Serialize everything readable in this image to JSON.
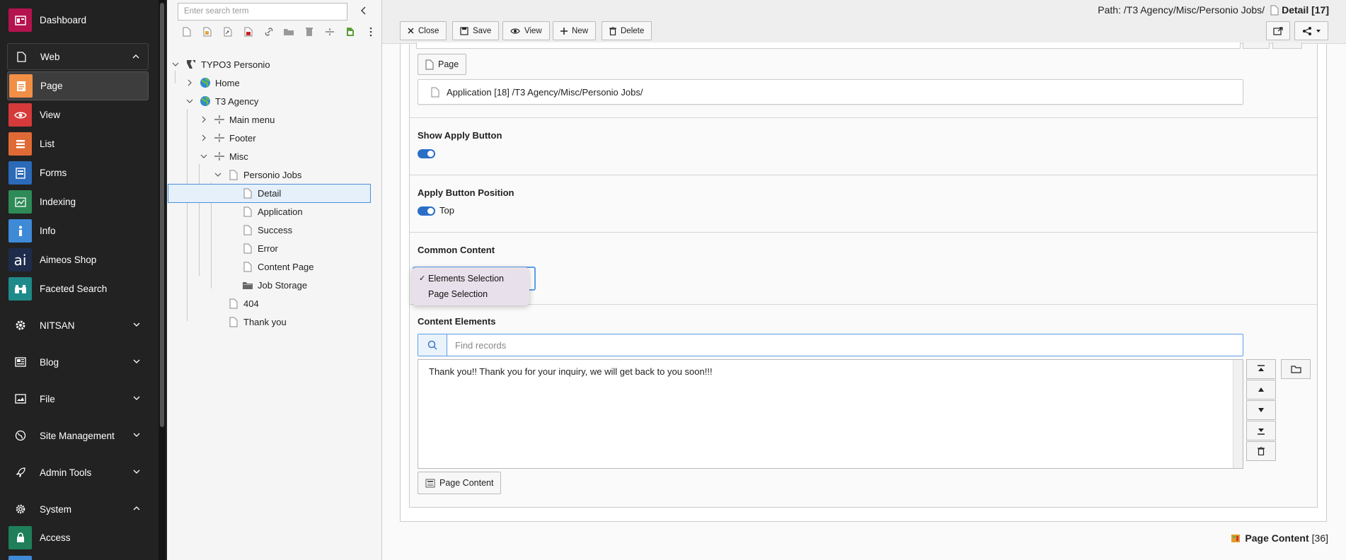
{
  "module_menu": {
    "dashboard": "Dashboard",
    "web_group": "Web",
    "items": [
      {
        "label": "Page",
        "icon": "page-icon",
        "color": "#f18f47"
      },
      {
        "label": "View",
        "icon": "eye-icon",
        "color": "#d63a3a"
      },
      {
        "label": "List",
        "icon": "list-icon",
        "color": "#e06a36"
      },
      {
        "label": "Forms",
        "icon": "forms-icon",
        "color": "#2a6ab8"
      },
      {
        "label": "Indexing",
        "icon": "indexing-icon",
        "color": "#2e8b57"
      },
      {
        "label": "Info",
        "icon": "info-icon",
        "color": "#3f8ad7"
      },
      {
        "label": "Aimeos Shop",
        "icon": "aimeos-icon",
        "color": "#1e2b4a"
      },
      {
        "label": "Faceted Search",
        "icon": "binoculars-icon",
        "color": "#1f8a8a"
      }
    ],
    "groups": [
      "NITSAN",
      "Blog",
      "File",
      "Site Management",
      "Admin Tools",
      "System"
    ],
    "system_items": [
      {
        "label": "Access",
        "icon": "lock-icon",
        "color": "#1e7f5a"
      }
    ]
  },
  "page_tree": {
    "search_placeholder": "Enter search term",
    "nodes": [
      {
        "label": "TYPO3 Personio"
      },
      {
        "label": "Home"
      },
      {
        "label": "T3 Agency"
      },
      {
        "label": "Main menu"
      },
      {
        "label": "Footer"
      },
      {
        "label": "Misc"
      },
      {
        "label": "Personio Jobs"
      },
      {
        "label": "Detail"
      },
      {
        "label": "Application"
      },
      {
        "label": "Success"
      },
      {
        "label": "Error"
      },
      {
        "label": "Content Page"
      },
      {
        "label": "Job Storage"
      },
      {
        "label": "404"
      },
      {
        "label": "Thank you"
      }
    ]
  },
  "doc_header": {
    "path_prefix": "Path: /T3 Agency/Misc/Personio Jobs/",
    "page_title": "Detail [17]",
    "buttons": {
      "close": "Close",
      "save": "Save",
      "view": "View",
      "new": "New",
      "delete": "Delete"
    }
  },
  "form": {
    "page_button": "Page",
    "page_record": "Application [18] /T3 Agency/Misc/Personio Jobs/",
    "show_apply_button": {
      "label": "Show Apply Button",
      "enabled": true
    },
    "apply_button_position": {
      "label": "Apply Button Position",
      "value": "Top"
    },
    "common_content": {
      "label": "Common Content",
      "options": [
        "Elements Selection",
        "Page Selection"
      ],
      "selected": "Elements Selection"
    },
    "content_elements": {
      "label": "Content Elements",
      "find_placeholder": "Find records",
      "selected_item": "Thank you!! Thank you for your inquiry, we will get back to you soon!!!",
      "add_button": "Page Content"
    }
  },
  "footer": {
    "record_label": "Page Content",
    "record_id": "[36]"
  }
}
